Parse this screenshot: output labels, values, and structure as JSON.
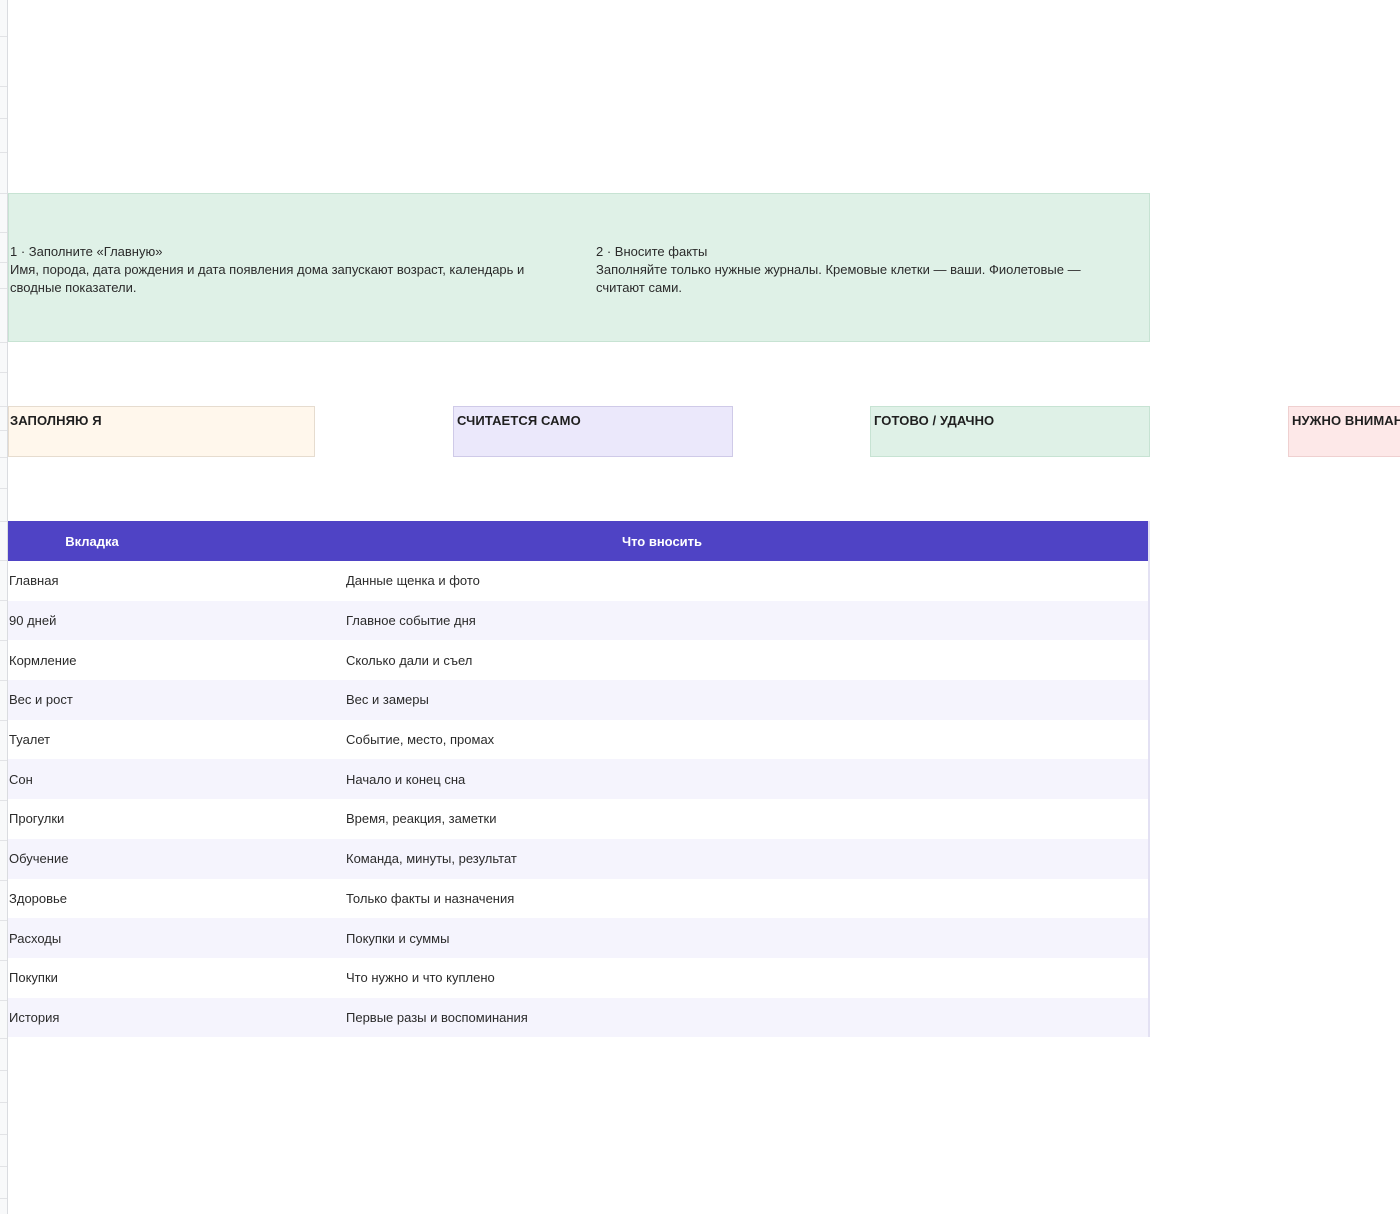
{
  "instructions": {
    "step1": {
      "title": "1 · Заполните «Главную»",
      "text": "Имя, порода, дата рождения и дата появления дома запускают возраст, календарь и сводные показатели."
    },
    "step2": {
      "title": "2 · Вносите факты",
      "text": "Заполняйте только нужные журналы. Кремовые клетки — ваши. Фиолетовые — считают сами."
    }
  },
  "legend": {
    "fill": "ЗАПОЛНЯЮ Я",
    "auto": "СЧИТАЕТСЯ САМО",
    "done": "ГОТОВО / УДАЧНО",
    "attention": "НУЖНО ВНИМАНИЕ"
  },
  "colors": {
    "header": "#4f43c5",
    "cream": "#fff7ec",
    "violet": "#ebe8fb",
    "green": "#dff1e7",
    "red": "#fde8e8"
  },
  "table": {
    "headers": [
      "Вкладка",
      "Что вносить"
    ],
    "rows": [
      [
        "Главная",
        "Данные щенка и фото"
      ],
      [
        "90 дней",
        "Главное событие дня"
      ],
      [
        "Кормление",
        "Сколько дали и съел"
      ],
      [
        "Вес и рост",
        "Вес и замеры"
      ],
      [
        "Туалет",
        "Событие, место, промах"
      ],
      [
        "Сон",
        "Начало и конец сна"
      ],
      [
        "Прогулки",
        "Время, реакция, заметки"
      ],
      [
        "Обучение",
        "Команда, минуты, результат"
      ],
      [
        "Здоровье",
        "Только факты и назначения"
      ],
      [
        "Расходы",
        "Покупки и суммы"
      ],
      [
        "Покупки",
        "Что нужно и что куплено"
      ],
      [
        "История",
        "Первые разы и воспоминания"
      ]
    ]
  }
}
